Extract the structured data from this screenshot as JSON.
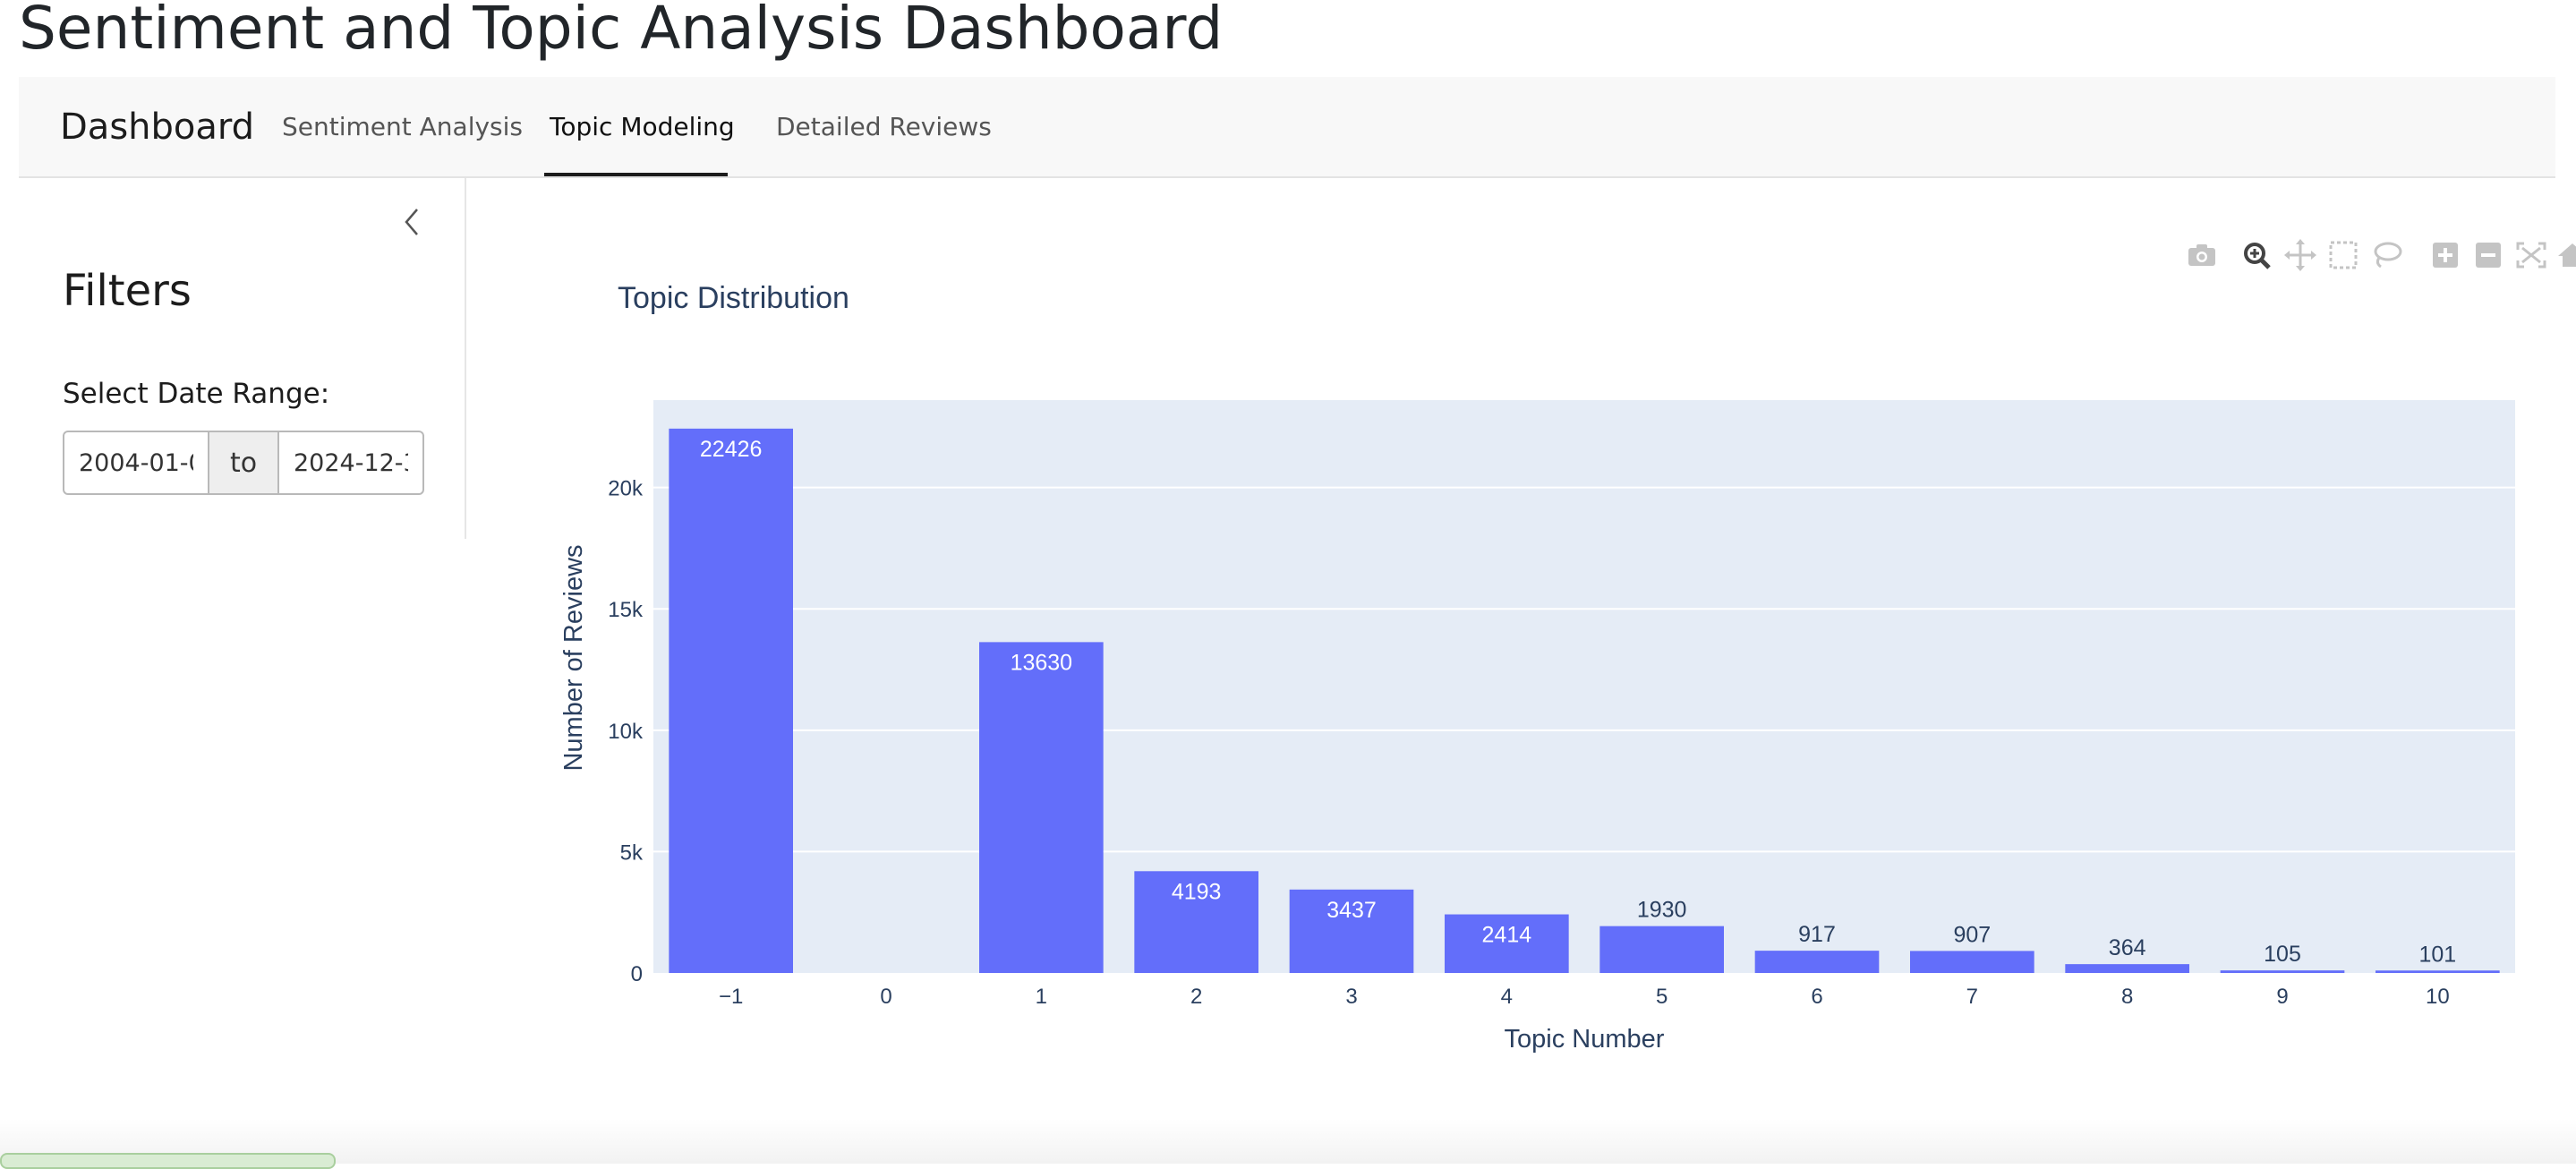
{
  "page": {
    "title": "Sentiment and Topic Analysis Dashboard"
  },
  "navbar": {
    "brand": "Dashboard",
    "tabs": [
      {
        "label": "Sentiment Analysis",
        "active": false
      },
      {
        "label": "Topic Modeling",
        "active": true
      },
      {
        "label": "Detailed Reviews",
        "active": false
      }
    ]
  },
  "sidebar": {
    "collapse_icon": "chevron-left-icon",
    "title": "Filters",
    "date_label": "Select Date Range:",
    "date_start": "2004-01-0",
    "date_separator": "to",
    "date_end": "2024-12-3"
  },
  "modebar": {
    "icons": [
      "camera-icon",
      "zoom-icon",
      "pan-icon",
      "box-select-icon",
      "lasso-select-icon",
      "zoom-in-icon",
      "zoom-out-icon",
      "autoscale-icon",
      "reset-axes-icon"
    ]
  },
  "colors": {
    "bar": "#636efa",
    "plot_bg": "#e5ecf6",
    "grid": "#ffffff",
    "text": "#2a3f5f"
  },
  "chart_data": {
    "type": "bar",
    "title": "Topic Distribution",
    "xlabel": "Topic Number",
    "ylabel": "Number of Reviews",
    "categories": [
      "−1",
      "0",
      "1",
      "2",
      "3",
      "4",
      "5",
      "6",
      "7",
      "8",
      "9",
      "10"
    ],
    "values": [
      22426,
      0,
      13630,
      4193,
      3437,
      2414,
      1930,
      917,
      907,
      364,
      105,
      101
    ],
    "ylim": [
      0,
      23600
    ],
    "y_ticks": [
      0,
      5000,
      10000,
      15000,
      20000
    ],
    "y_tick_labels": [
      "0",
      "5k",
      "10k",
      "15k",
      "20k"
    ],
    "data_labels": true,
    "grid": true,
    "legend": false
  }
}
